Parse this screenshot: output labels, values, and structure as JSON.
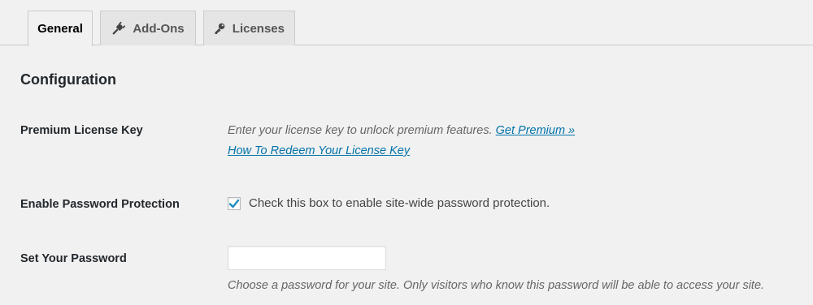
{
  "tabs": [
    {
      "label": "General",
      "icon": "",
      "active": true
    },
    {
      "label": "Add-Ons",
      "icon": "plug-icon",
      "active": false
    },
    {
      "label": "Licenses",
      "icon": "key-icon",
      "active": false
    }
  ],
  "section": {
    "title": "Configuration"
  },
  "license": {
    "label": "Premium License Key",
    "description": "Enter your license key to unlock premium features.",
    "get_premium_link": "Get Premium »",
    "redeem_link": "How To Redeem Your License Key"
  },
  "protection": {
    "label": "Enable Password Protection",
    "checked": true,
    "checkbox_text": "Check this box to enable site-wide password protection."
  },
  "password": {
    "label": "Set Your Password",
    "value": "",
    "description": "Choose a password for your site. Only visitors who know this password will be able to access your site."
  },
  "colors": {
    "link": "#0073aa",
    "checkmark": "#1e8cbe",
    "background": "#f1f1f1"
  }
}
